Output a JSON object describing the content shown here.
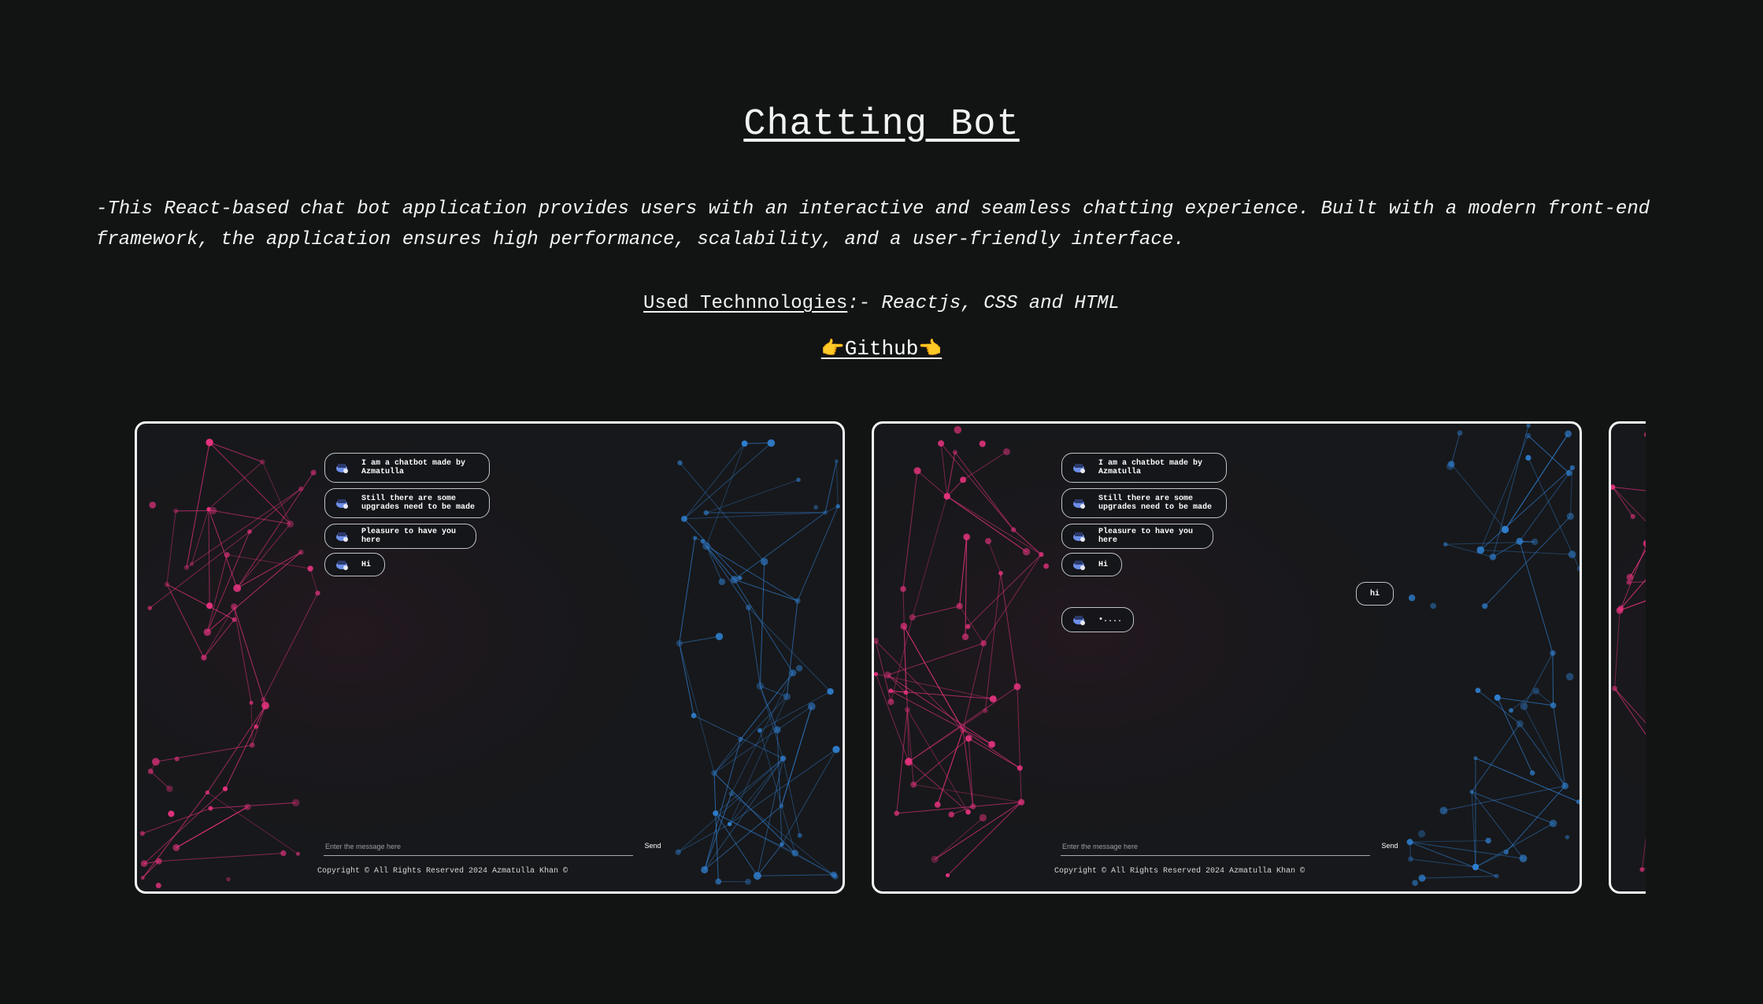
{
  "page": {
    "title": "Chatting Bot",
    "description": "-This React-based chat bot application provides users with an interactive and seamless chatting experience. Built with a modern front-end framework, the application ensures high performance, scalability, and a user-friendly interface.",
    "technologies_label": "Used Technnologies",
    "technologies_value": ":- Reactjs, CSS and HTML",
    "github_label": "Github",
    "github_hand_left": "👉",
    "github_hand_right": "👈"
  },
  "slides": [
    {
      "messages": [
        "I am a chatbot made by\nAzmatulla",
        "Still there are some\nupgrades need to be made",
        "Pleasure to have you here",
        "Hi"
      ],
      "input_placeholder": "Enter the message here",
      "send_label": "Send",
      "copyright": "Copyright © All Rights Reserved 2024 Azmatulla Khan ©"
    },
    {
      "messages": [
        "I am a chatbot made by\nAzmatulla",
        "Still there are some\nupgrades need to be made",
        "Pleasure to have you here",
        "Hi"
      ],
      "user_message": "hi",
      "typing_indicator": "•....",
      "input_placeholder": "Enter the message here",
      "send_label": "Send",
      "copyright": "Copyright © All Rights Reserved 2024 Azmatulla Khan ©"
    }
  ],
  "colors": {
    "background": "#121414",
    "text": "#f2f2f2",
    "network_pink": "#e8337f",
    "network_blue": "#2f7fd0",
    "slide_border": "#f4f4f4"
  }
}
